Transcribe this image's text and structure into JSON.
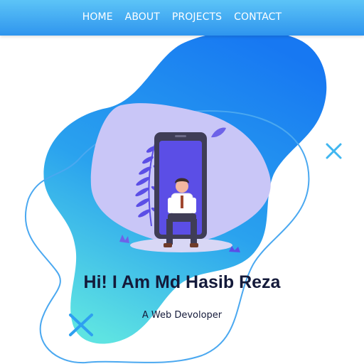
{
  "nav": {
    "items": [
      {
        "label": "HOME"
      },
      {
        "label": "ABOUT"
      },
      {
        "label": "PROJECTS"
      },
      {
        "label": "CONTACT"
      }
    ]
  },
  "hero": {
    "title": "Hi! I Am Md Hasib Reza",
    "subtitle": "A Web Devoloper"
  },
  "colors": {
    "nav_top": "#5cc4f7",
    "nav_bottom": "#2f95ee",
    "blob_top": "#1778f2",
    "blob_bottom": "#5ee3e2",
    "accent_purple": "#5b4ee6",
    "title_text": "#141a3a"
  },
  "icons": [
    "close-x-icon",
    "smartphone-illustration",
    "fern-leaf-icon",
    "person-sitting-illustration"
  ]
}
